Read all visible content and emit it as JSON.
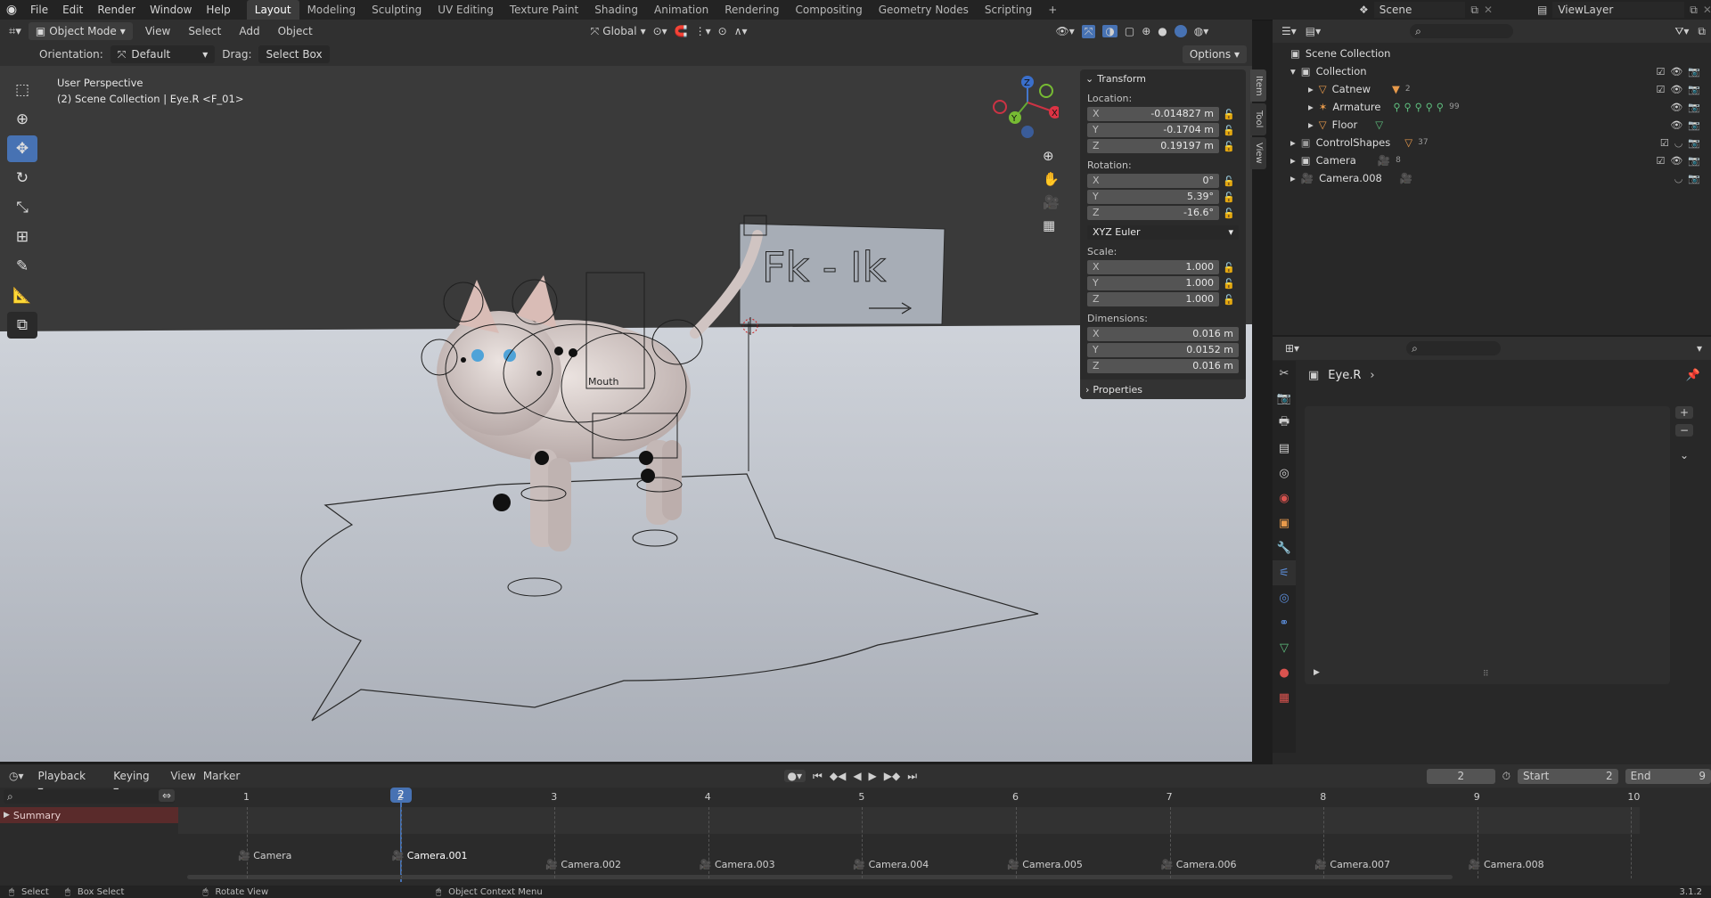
{
  "menu": {
    "items": [
      "File",
      "Edit",
      "Render",
      "Window",
      "Help"
    ]
  },
  "workspaces": [
    "Layout",
    "Modeling",
    "Sculpting",
    "UV Editing",
    "Texture Paint",
    "Shading",
    "Animation",
    "Rendering",
    "Compositing",
    "Geometry Nodes",
    "Scripting"
  ],
  "active_workspace": "Layout",
  "scene": {
    "label": "Scene"
  },
  "viewlayer": {
    "label": "ViewLayer"
  },
  "viewport_header": {
    "mode": "Object Mode",
    "menus": [
      "View",
      "Select",
      "Add",
      "Object"
    ],
    "transform_orientation": "Global"
  },
  "tool_settings": {
    "orientation_label": "Orientation:",
    "orientation": "Default",
    "drag_label": "Drag:",
    "drag": "Select Box",
    "options": "Options"
  },
  "viewport_info": {
    "line1": "User Perspective",
    "line2": "(2) Scene Collection | Eye.R <F_01>"
  },
  "scene_text": {
    "fkik": "Fk  -  Ik",
    "mouth": "Mouth"
  },
  "gizmo": {
    "x": "X",
    "y": "Y",
    "z": "Z"
  },
  "npanel": {
    "title": "Transform",
    "location_label": "Location:",
    "location": {
      "x": "-0.014827 m",
      "y": "-0.1704 m",
      "z": "0.19197 m"
    },
    "rotation_label": "Rotation:",
    "rotation": {
      "x": "0°",
      "y": "5.39°",
      "z": "-16.6°"
    },
    "rotation_mode": "XYZ Euler",
    "scale_label": "Scale:",
    "scale": {
      "x": "1.000",
      "y": "1.000",
      "z": "1.000"
    },
    "dimensions_label": "Dimensions:",
    "dimensions": {
      "x": "0.016 m",
      "y": "0.0152 m",
      "z": "0.016 m"
    },
    "properties": "Properties",
    "tabs": [
      "Item",
      "Tool",
      "View"
    ]
  },
  "outliner": {
    "root": "Scene Collection",
    "items": [
      {
        "name": "Collection"
      },
      {
        "name": "Catnew",
        "badge": "2"
      },
      {
        "name": "Armature",
        "badge": "99"
      },
      {
        "name": "Floor"
      },
      {
        "name": "ControlShapes",
        "badge": "37"
      },
      {
        "name": "Camera",
        "badge": "8"
      },
      {
        "name": "Camera.008"
      }
    ]
  },
  "properties": {
    "object": "Eye.R"
  },
  "timeline": {
    "menus": [
      "Playback",
      "Keying",
      "View",
      "Marker"
    ],
    "current_frame": "2",
    "start_label": "Start",
    "start": "2",
    "end_label": "End",
    "end": "9",
    "summary": "Summary",
    "ticks": [
      "1",
      "2",
      "3",
      "4",
      "5",
      "6",
      "7",
      "8",
      "9",
      "10"
    ],
    "markers": [
      "Camera",
      "Camera.001",
      "Camera.002",
      "Camera.003",
      "Camera.004",
      "Camera.005",
      "Camera.006",
      "Camera.007",
      "Camera.008"
    ]
  },
  "status": {
    "select": "Select",
    "box_select": "Box Select",
    "rotate": "Rotate View",
    "context": "Object Context Menu",
    "version": "3.1.2"
  },
  "colors": {
    "accent": "#4772b3",
    "viewport_bg": "#3a3a3a",
    "floor": "#b9bec6",
    "summary": "#5a2b2b"
  }
}
